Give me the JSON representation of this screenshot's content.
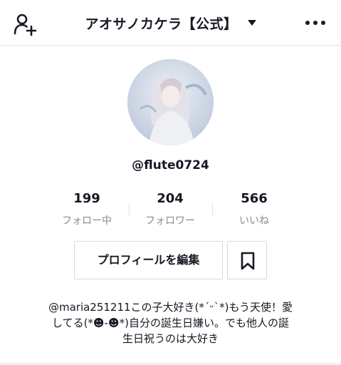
{
  "header": {
    "title": "アオサノカケラ【公式】",
    "add_user_icon": "person-add-icon",
    "dropdown_icon": "caret-down-icon",
    "more_icon": "more-horizontal-icon"
  },
  "profile": {
    "username": "@flute0724",
    "avatar_icon": "profile-avatar"
  },
  "stats": [
    {
      "value": "199",
      "label": "フォロー中"
    },
    {
      "value": "204",
      "label": "フォロワー"
    },
    {
      "value": "566",
      "label": "いいね"
    }
  ],
  "actions": {
    "edit_profile_label": "プロフィールを編集",
    "bookmark_icon": "bookmark-icon"
  },
  "bio": {
    "line1": "@maria251211この子大好き(*´ᵕ`*)もう天使！愛",
    "line2": "してる(*☻-☻*)自分の誕生日嫌い。でも他人の誕",
    "line3": "生日祝うのは大好き"
  },
  "colors": {
    "text": "#161823",
    "secondary": "#8a8b91",
    "border": "#d9d9db"
  }
}
